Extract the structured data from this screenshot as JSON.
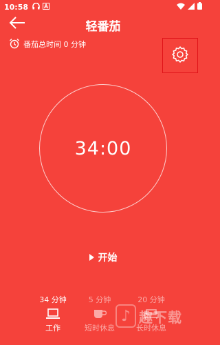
{
  "status_bar": {
    "time": "10:58",
    "left_icons": [
      "headset-icon",
      "a-badge-icon"
    ],
    "right_icons": [
      "wifi-icon",
      "signal-icon",
      "battery-icon"
    ]
  },
  "header": {
    "title": "轻番茄",
    "back_icon": "arrow-left-icon"
  },
  "summary": {
    "total_time_text": "番茄总时间 0 分钟",
    "icon": "alarm-clock-icon"
  },
  "settings": {
    "icon": "gear-icon"
  },
  "timer": {
    "display": "34:00"
  },
  "start": {
    "label": "开始",
    "icon": "play-icon"
  },
  "modes": [
    {
      "duration": "34 分钟",
      "label": "工作",
      "icon": "laptop-icon",
      "active": true
    },
    {
      "duration": "5 分钟",
      "label": "短时休息",
      "icon": "coffee-cup-icon",
      "active": false
    },
    {
      "duration": "20 分钟",
      "label": "长时休息",
      "icon": "sofa-icon",
      "active": false
    }
  ],
  "watermark": {
    "text": "趣下载",
    "icon": "music-note-logo"
  },
  "colors": {
    "background": "#f5423b",
    "settings_highlight": "#e0151a",
    "foreground": "#ffffff"
  }
}
